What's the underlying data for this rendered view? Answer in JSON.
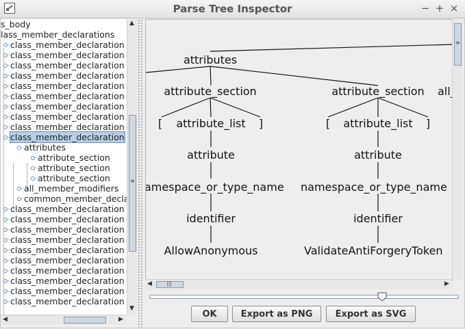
{
  "window": {
    "title": "Parse Tree Inspector",
    "controls": [
      "−",
      "+",
      "×"
    ]
  },
  "tree": {
    "items": [
      {
        "label": "s_body"
      },
      {
        "label": "lass_member_declarations"
      },
      {
        "label": "class_member_declaration"
      },
      {
        "label": "class_member_declaration"
      },
      {
        "label": "class_member_declaration"
      },
      {
        "label": "class_member_declaration"
      },
      {
        "label": "class_member_declaration"
      },
      {
        "label": "class_member_declaration"
      },
      {
        "label": "class_member_declaration"
      },
      {
        "label": "class_member_declaration"
      },
      {
        "label": "class_member_declaration"
      },
      {
        "label": "class_member_declaration",
        "selected": true
      },
      {
        "label": "attributes"
      },
      {
        "label": "attribute_section"
      },
      {
        "label": "attribute_section"
      },
      {
        "label": "attribute_section"
      },
      {
        "label": "all_member_modifiers"
      },
      {
        "label": "common_member_decla"
      },
      {
        "label": "class_member_declaration"
      },
      {
        "label": "class_member_declaration"
      },
      {
        "label": "class_member_declaration"
      },
      {
        "label": "class_member_declaration"
      },
      {
        "label": "class_member_declaration"
      },
      {
        "label": "class_member_declaration"
      },
      {
        "label": "class_member_declaration"
      },
      {
        "label": "class_member_declaration"
      },
      {
        "label": "class_member_declaration"
      },
      {
        "label": "class_member_declaration"
      }
    ]
  },
  "parse_tree": {
    "root": "attributes",
    "section_left": "attribute_section",
    "section_right": "attribute_section",
    "section_cut": "all_",
    "open_bracket": "[",
    "attr_list": "attribute_list",
    "close_bracket": "]",
    "attribute": "attribute",
    "ns_left": "amespace_or_type_name",
    "ns_right": "namespace_or_type_name",
    "identifier": "identifier",
    "leaf_left": "AllowAnonymous",
    "leaf_right": "ValidateAntiForgeryToken"
  },
  "zoom_level": 0.76,
  "buttons": {
    "ok": "OK",
    "export_png": "Export as PNG",
    "export_svg": "Export as SVG"
  }
}
